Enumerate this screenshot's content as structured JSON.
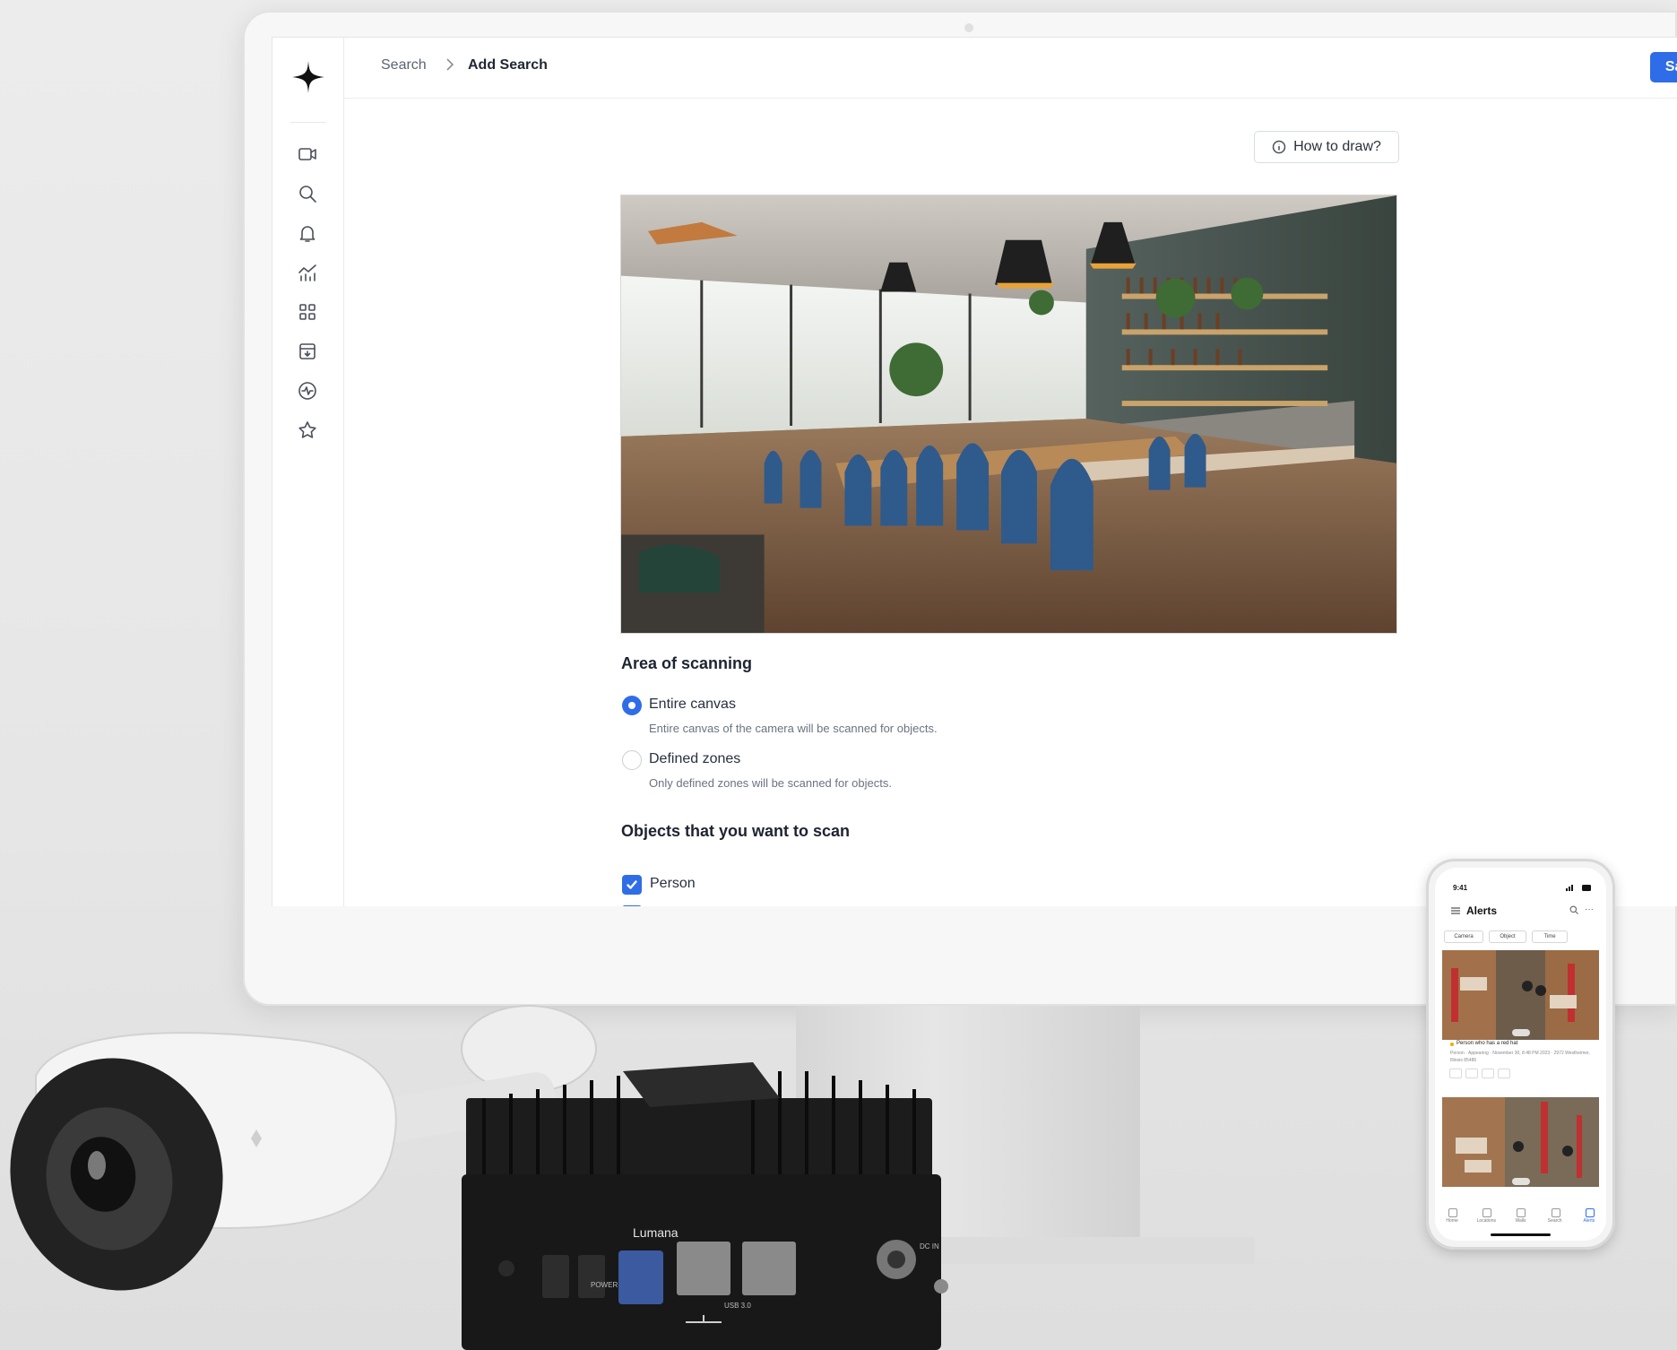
{
  "app": {
    "breadcrumb": {
      "parent": "Search",
      "current": "Add Search"
    },
    "save_label": "Save",
    "howto_label": "How to draw?",
    "nav": [
      "video-camera-icon",
      "search-icon",
      "bell-icon",
      "analytics-icon",
      "grid-icon",
      "archive-download-icon",
      "activity-icon",
      "star-icon"
    ],
    "area": {
      "title": "Area of scanning",
      "options": [
        {
          "label": "Entire canvas",
          "description": "Entire canvas of the camera will be scanned for objects.",
          "selected": true
        },
        {
          "label": "Defined zones",
          "description": "Only defined zones will be scanned for objects.",
          "selected": false
        }
      ]
    },
    "objects": {
      "title": "Objects that you want to scan",
      "items": [
        {
          "label": "Person",
          "checked": true
        }
      ]
    },
    "accent_color": "#2f6de8"
  },
  "device": {
    "brand": "Lumana",
    "power_label": "POWER",
    "usb_label": "USB 3.0",
    "dc_label": "DC IN"
  },
  "phone": {
    "time": "9:41",
    "title": "Alerts",
    "filters": [
      "Camera",
      "Object",
      "Time"
    ],
    "alert": {
      "title": "Person who has a red hat",
      "meta": "Person · Appearing · November 30, 8:48 PM 2023 · 2972 Westheimer, Illinois 85486",
      "image_counter": "1/12",
      "image_counter_2": "1/12"
    },
    "tabs": [
      "Home",
      "Locations",
      "Walls",
      "Search",
      "Alerts"
    ],
    "active_tab": "Alerts"
  }
}
